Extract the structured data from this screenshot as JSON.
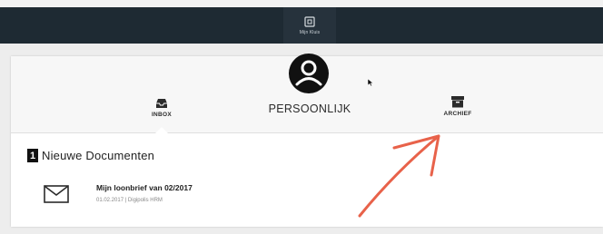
{
  "topbar": {
    "vault_label": "Mijn Kluis"
  },
  "header": {
    "title": "PERSOONLIJK"
  },
  "tabs": {
    "inbox": "INBOX",
    "archief": "ARCHIEF"
  },
  "section": {
    "count": "1",
    "title": "Nieuwe Documenten"
  },
  "documents": [
    {
      "title": "Mijn loonbrief van 02/2017",
      "meta": "01.02.2017 | Digipolis HRM"
    }
  ],
  "colors": {
    "topbar": "#1e2a33",
    "annotation": "#e8624a"
  },
  "icons": {
    "vault": "vault-icon",
    "avatar": "user-avatar-icon",
    "inbox": "inbox-tray-icon",
    "archief": "archive-box-icon",
    "document": "envelope-icon"
  }
}
